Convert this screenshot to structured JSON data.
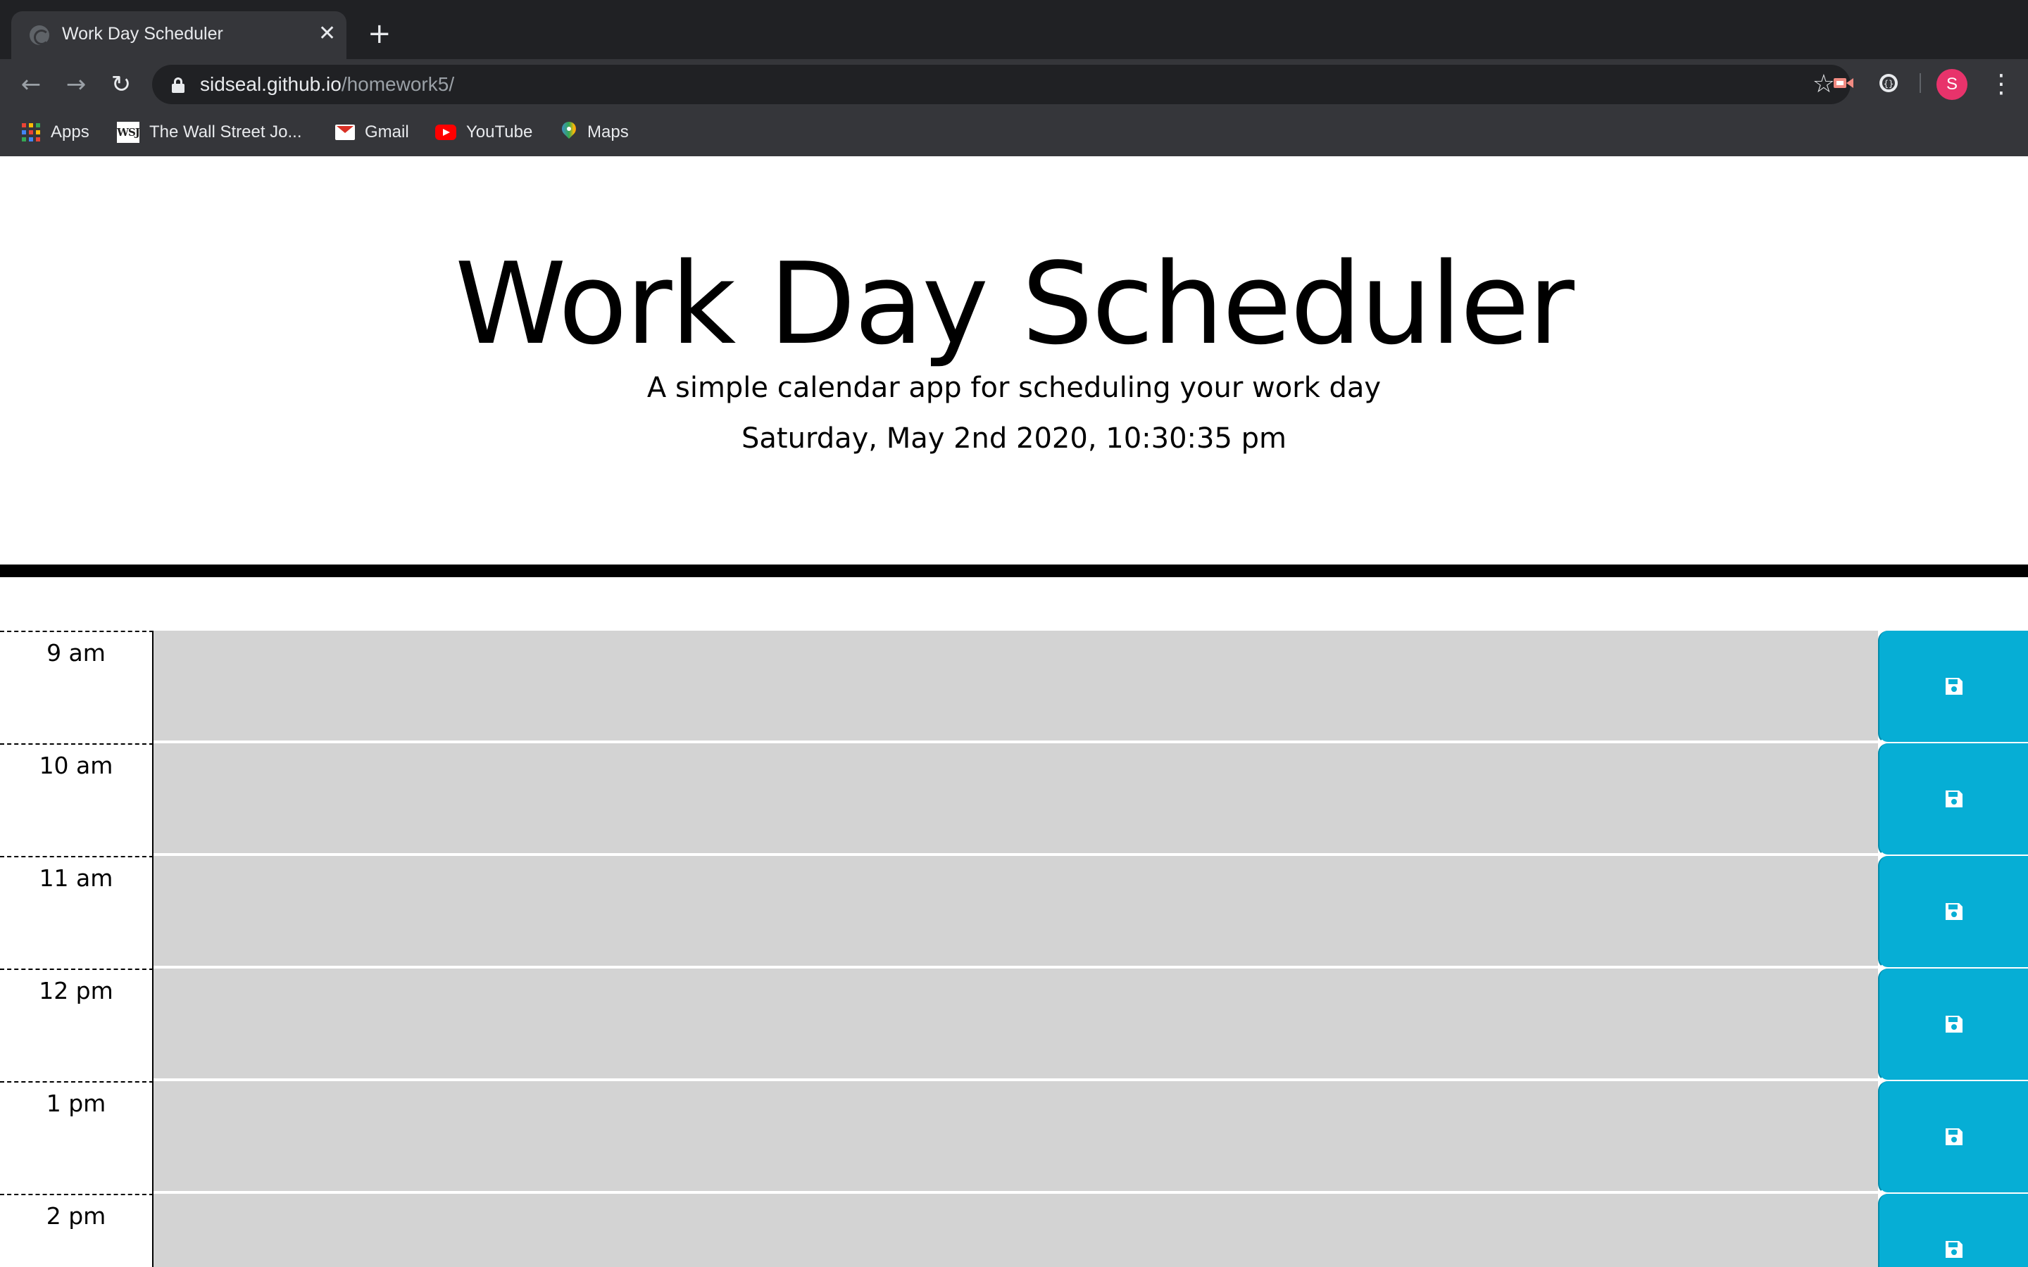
{
  "browser": {
    "tab_title": "Work Day Scheduler",
    "tab_close": "✕",
    "new_tab": "+",
    "url_host": "sidseal.github.io",
    "url_path": "/homework5/",
    "avatar_letter": "S",
    "bookmarks": [
      {
        "label": "Apps",
        "icon": "apps-grid-icon"
      },
      {
        "label": "The Wall Street Jo...",
        "icon": "wsj-icon"
      },
      {
        "label": "Gmail",
        "icon": "gmail-icon"
      },
      {
        "label": "YouTube",
        "icon": "youtube-icon"
      },
      {
        "label": "Maps",
        "icon": "maps-icon"
      }
    ],
    "wsj_logo_text": "WSJ"
  },
  "header": {
    "title": "Work Day Scheduler",
    "lead": "A simple calendar app for scheduling your work day",
    "current_day": "Saturday, May 2nd 2020, 10:30:35 pm"
  },
  "timeblocks": [
    {
      "hour": "9 am",
      "text": "",
      "state": "past"
    },
    {
      "hour": "10 am",
      "text": "",
      "state": "past"
    },
    {
      "hour": "11 am",
      "text": "",
      "state": "past"
    },
    {
      "hour": "12 pm",
      "text": "",
      "state": "past"
    },
    {
      "hour": "1 pm",
      "text": "",
      "state": "past"
    },
    {
      "hour": "2 pm",
      "text": "",
      "state": "past"
    }
  ],
  "colors": {
    "past": "#d3d3d3",
    "save_button": "#06aed5",
    "chrome_dark": "#202124",
    "chrome_toolbar": "#35363a"
  }
}
